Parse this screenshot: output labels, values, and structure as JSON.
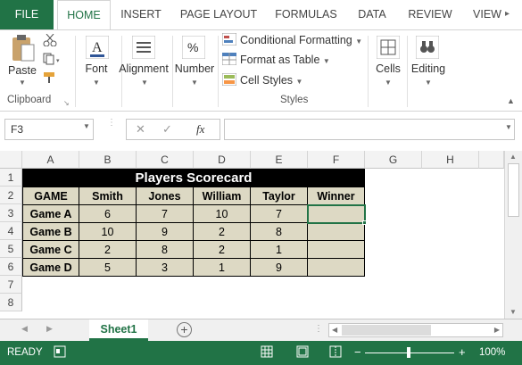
{
  "ribbon_tabs": [
    "FILE",
    "HOME",
    "INSERT",
    "PAGE LAYOUT",
    "FORMULAS",
    "DATA",
    "REVIEW",
    "VIEW"
  ],
  "clipboard": {
    "paste_label": "Paste",
    "group_label": "Clipboard"
  },
  "font": {
    "label": "Font"
  },
  "alignment": {
    "label": "Alignment"
  },
  "number": {
    "label": "Number"
  },
  "styles": {
    "conditional_formatting": "Conditional Formatting",
    "format_as_table": "Format as Table",
    "cell_styles": "Cell Styles",
    "group_label": "Styles"
  },
  "cells": {
    "label": "Cells"
  },
  "editing": {
    "label": "Editing"
  },
  "formula_bar": {
    "name_box": "F3",
    "fx_label": "fx",
    "cancel": "✕",
    "enter": "✓",
    "value": ""
  },
  "columns": [
    "A",
    "B",
    "C",
    "D",
    "E",
    "F",
    "G",
    "H"
  ],
  "rows": [
    "1",
    "2",
    "3",
    "4",
    "5",
    "6",
    "7",
    "8"
  ],
  "sheet": {
    "title": "Players Scorecard",
    "headers": [
      "GAME",
      "Smith",
      "Jones",
      "William",
      "Taylor",
      "Winner"
    ],
    "data": [
      [
        "Game A",
        "6",
        "7",
        "10",
        "7",
        ""
      ],
      [
        "Game B",
        "10",
        "9",
        "2",
        "8",
        ""
      ],
      [
        "Game C",
        "2",
        "8",
        "2",
        "1",
        ""
      ],
      [
        "Game D",
        "5",
        "3",
        "1",
        "9",
        ""
      ]
    ]
  },
  "sheet_tabs": {
    "active": "Sheet1",
    "add": "+"
  },
  "status": {
    "ready": "READY",
    "zoom": "100%"
  },
  "colors": {
    "accent": "#217346",
    "table_fill": "#ddd9c4",
    "title_fill": "#000000"
  }
}
